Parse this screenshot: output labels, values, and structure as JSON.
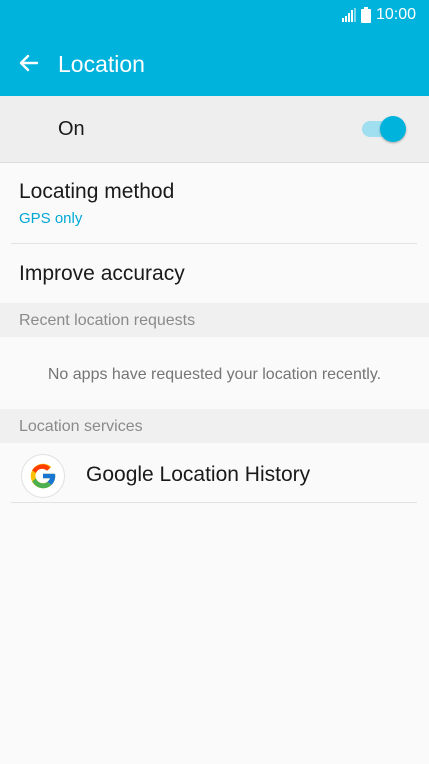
{
  "status_bar": {
    "time": "10:00",
    "signal_icon": "signal-icon",
    "battery_icon": "battery-icon"
  },
  "app_bar": {
    "title": "Location",
    "back_icon": "arrow-back-icon"
  },
  "master_switch": {
    "label": "On",
    "state": "on"
  },
  "settings": {
    "locating_method": {
      "title": "Locating method",
      "value": "GPS only"
    },
    "improve_accuracy": {
      "title": "Improve accuracy"
    }
  },
  "recent_requests": {
    "header": "Recent location requests",
    "empty_text": "No apps have requested your location recently."
  },
  "location_services": {
    "header": "Location services",
    "items": [
      {
        "label": "Google Location History",
        "icon": "google-g-icon"
      }
    ]
  },
  "colors": {
    "accent": "#00b3dd",
    "accent_text": "#00a8d6",
    "toggle_track": "#9fdff0"
  }
}
